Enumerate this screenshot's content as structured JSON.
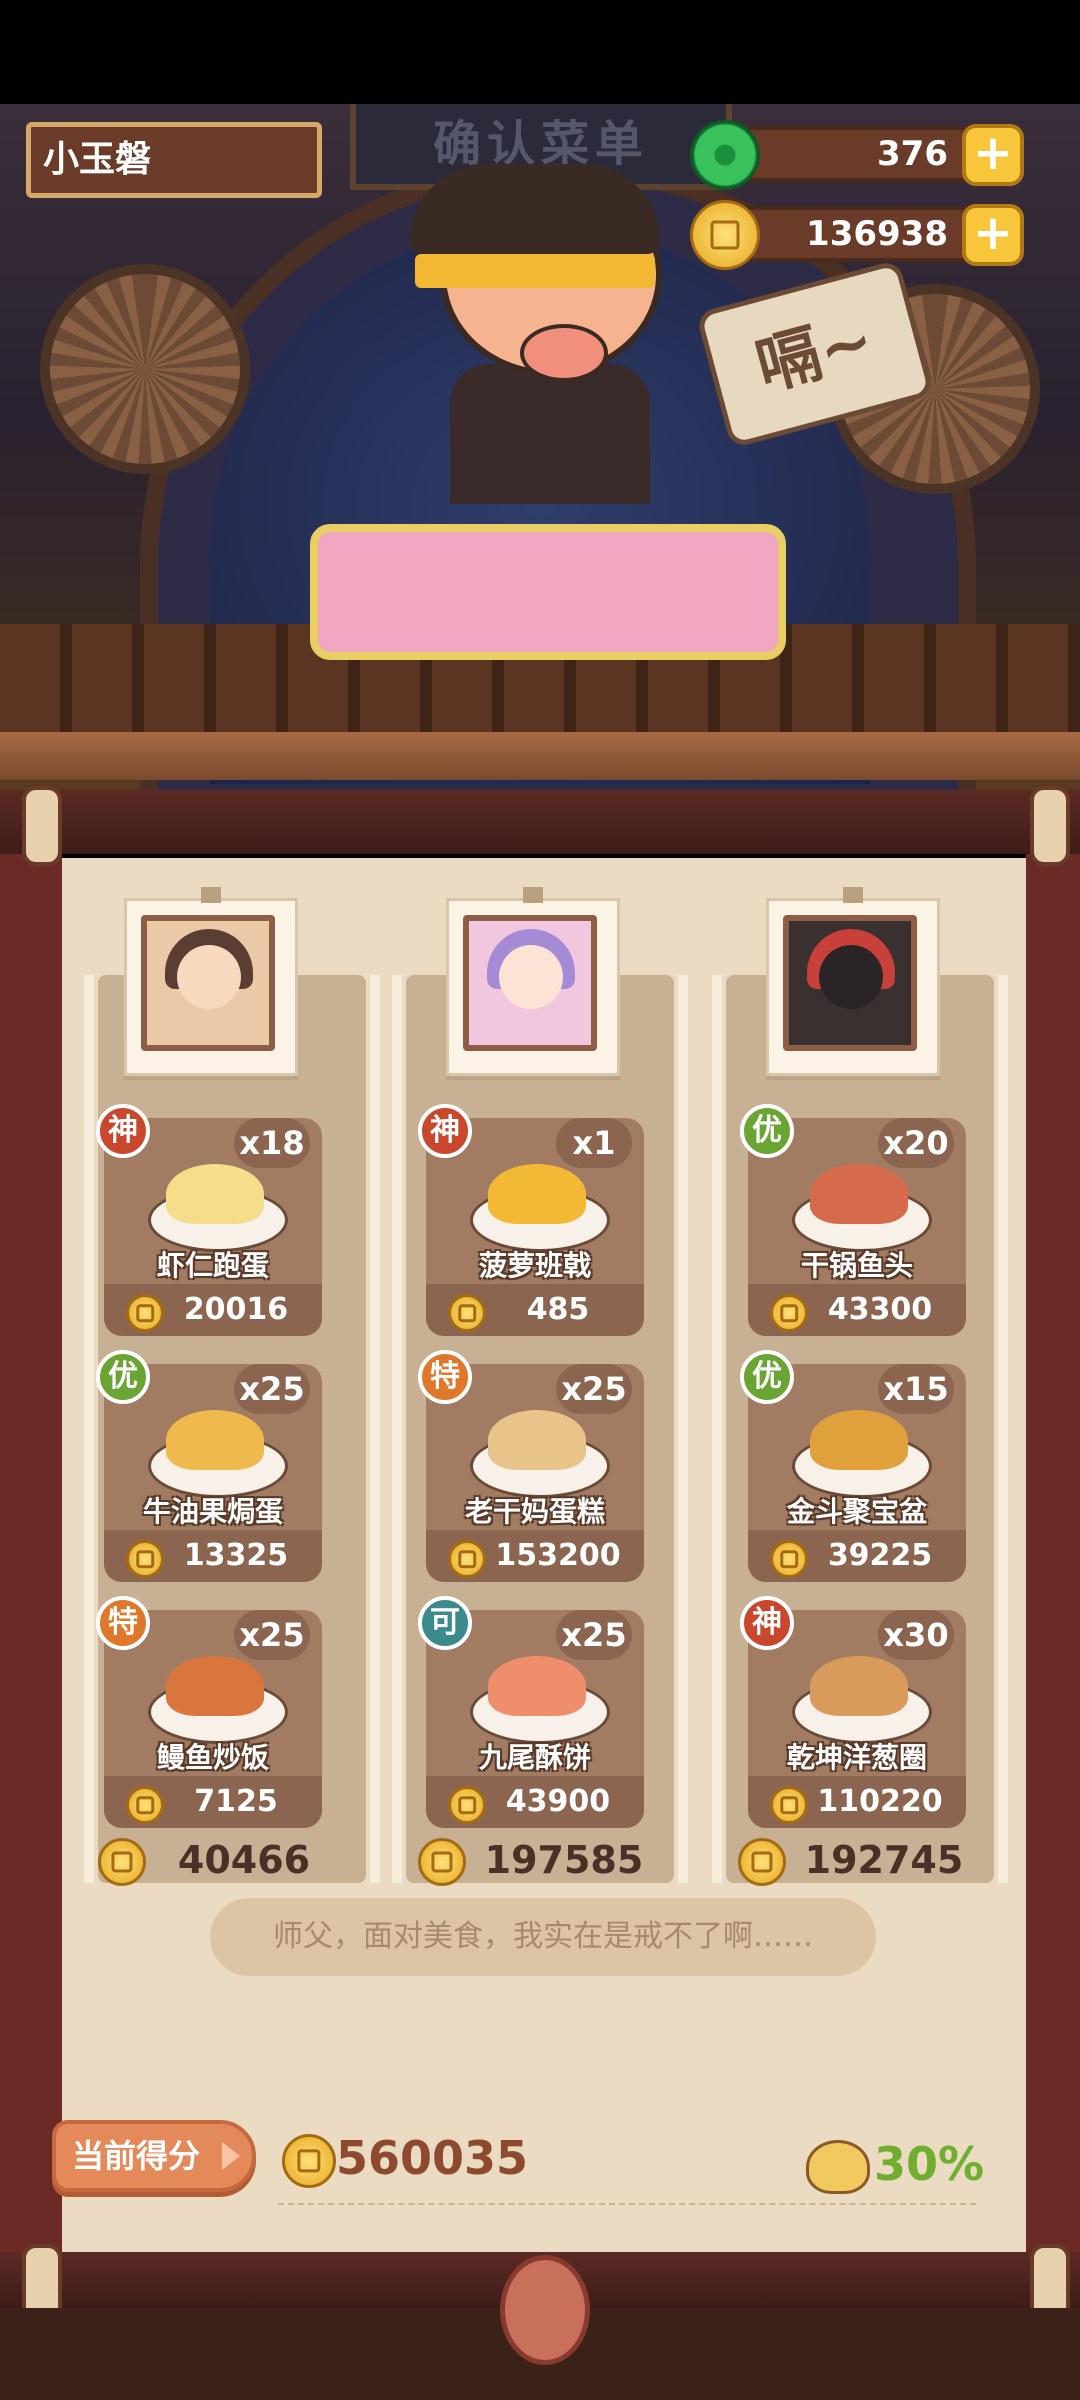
{
  "header": {
    "player_name": "小玉磐",
    "sign_text": "确认菜单",
    "jade_amount": "376",
    "coin_amount": "136938",
    "speech_tag": "嗝~"
  },
  "columns": [
    {
      "chef": "chef-elf",
      "total": "40466",
      "dishes": [
        {
          "grade": "神",
          "grade_color": "#c9472d",
          "qty": "x18",
          "name": "虾仁跑蛋",
          "price": "20016",
          "food_color": "#f6dd8a"
        },
        {
          "grade": "优",
          "grade_color": "#6aa433",
          "qty": "x25",
          "name": "牛油果焗蛋",
          "price": "13325",
          "food_color": "#f0b94d"
        },
        {
          "grade": "特",
          "grade_color": "#e0782c",
          "qty": "x25",
          "name": "鳗鱼炒饭",
          "price": "7125",
          "food_color": "#d9763e"
        }
      ]
    },
    {
      "chef": "chef-princess",
      "total": "197585",
      "dishes": [
        {
          "grade": "神",
          "grade_color": "#c9472d",
          "qty": "x1",
          "name": "菠萝班戟",
          "price": "485",
          "food_color": "#f3b934"
        },
        {
          "grade": "特",
          "grade_color": "#e0782c",
          "qty": "x25",
          "name": "老干妈蛋糕",
          "price": "153200",
          "food_color": "#e8c48a"
        },
        {
          "grade": "可",
          "grade_color": "#3c8a8c",
          "qty": "x25",
          "name": "九尾酥饼",
          "price": "43900",
          "food_color": "#ef8e6c"
        }
      ]
    },
    {
      "chef": "chef-beast",
      "total": "192745",
      "dishes": [
        {
          "grade": "优",
          "grade_color": "#6aa433",
          "qty": "x20",
          "name": "干锅鱼头",
          "price": "43300",
          "food_color": "#d56b4b"
        },
        {
          "grade": "优",
          "grade_color": "#6aa433",
          "qty": "x15",
          "name": "金斗聚宝盆",
          "price": "39225",
          "food_color": "#e0a03c"
        },
        {
          "grade": "神",
          "grade_color": "#c9472d",
          "qty": "x30",
          "name": "乾坤洋葱圈",
          "price": "110220",
          "food_color": "#d89b5c"
        }
      ]
    }
  ],
  "quote": "师父，面对美食，我实在是戒不了啊……",
  "score": {
    "button_label": "当前得分",
    "value": "560035",
    "bonus": "30%"
  }
}
